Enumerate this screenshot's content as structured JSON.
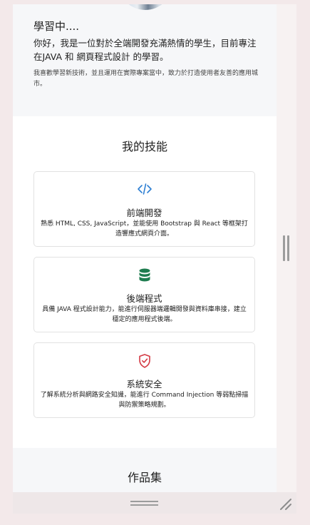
{
  "about": {
    "title": "學習中....",
    "body": "你好，我是一位對於全端開發充滿熱情的學生，目前專注在JAVA 和 網頁程式設計 的學習。",
    "sub": "我喜歡學習新技術，並且運用在實際專案當中，致力於打造使用者友善的應用城市。"
  },
  "skills": {
    "title": "我的技能",
    "items": [
      {
        "icon": "code-icon",
        "color": "#2d7fd3",
        "title": "前端開發",
        "desc": "熟悉 HTML, CSS, JavaScript，並能使用 Bootstrap 與 React 等框架打造響應式網頁介面。"
      },
      {
        "icon": "database-icon",
        "color": "#1e7c4f",
        "title": "後端程式",
        "desc": "具備 JAVA 程式設計能力，能進行伺服器端邏輯開發與資料庫串接，建立穩定的應用程式後端。"
      },
      {
        "icon": "shield-check-icon",
        "color": "#d43a44",
        "title": "系統安全",
        "desc": "了解系統分析與網路安全知識，能進行 Command Injection 等弱點掃描與防禦策略規劃。"
      }
    ]
  },
  "works": {
    "title": "作品集"
  }
}
